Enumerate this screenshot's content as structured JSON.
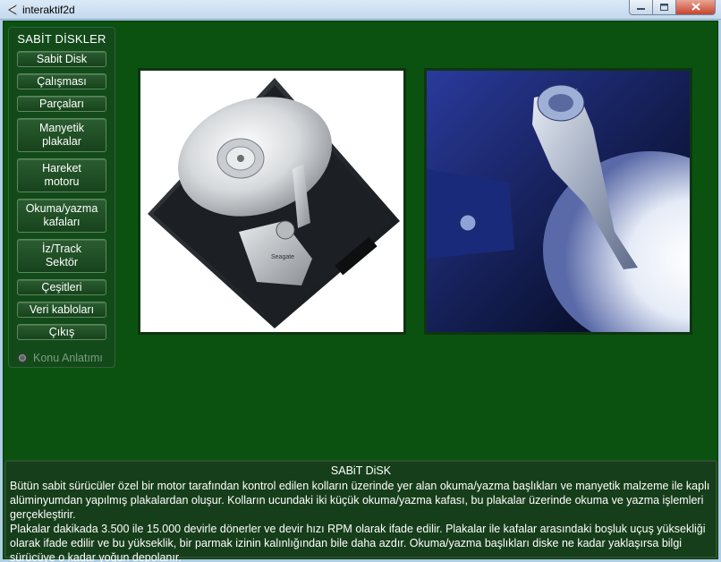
{
  "window": {
    "title": "interaktif2d",
    "minimize_icon": "minimize-icon",
    "maximize_icon": "maximize-icon",
    "close_icon": "close-icon"
  },
  "sidebar": {
    "title": "SABİT DİSKLER",
    "items": [
      {
        "label": "Sabit Disk"
      },
      {
        "label": "Çalışması"
      },
      {
        "label": "Parçaları"
      },
      {
        "label": "Manyetik\nplakalar"
      },
      {
        "label": "Hareket\nmotoru"
      },
      {
        "label": "Okuma/yazma\nkafaları"
      },
      {
        "label": "İz/Track\nSektör"
      },
      {
        "label": "Çeşitleri"
      },
      {
        "label": "Veri kabloları"
      },
      {
        "label": "Çıkış"
      }
    ],
    "radio_label": "Konu Anlatımı"
  },
  "images": {
    "left": {
      "name": "hard-disk-photo",
      "brand": "Seagate"
    },
    "right": {
      "name": "read-write-head-photo"
    }
  },
  "info": {
    "title": "SABiT DiSK",
    "paragraph1": "Bütün sabit sürücüler özel bir motor tarafından kontrol edilen kolların üzerinde yer alan okuma/yazma başlıkları ve manyetik malzeme ile kaplı alüminyumdan yapılmış plakalardan oluşur. Kolların ucundaki iki küçük okuma/yazma kafası, bu plakalar üzerinde okuma ve yazma işlemleri gerçekleştirir.",
    "paragraph2": "Plakalar dakikada 3.500 ile 15.000 devirle dönerler ve devir hızı RPM olarak ifade edilir. Plakalar ile kafalar arasındaki boşluk uçuş yüksekliği olarak ifade edilir ve bu yükseklik, bir parmak izinin kalınlığından bile daha azdır. Okuma/yazma başlıkları diske ne kadar yaklaşırsa bilgi sürücüye o kadar yoğun depolanır."
  },
  "colors": {
    "background": "#0b5210",
    "panel": "#134a1a",
    "info_panel": "#163e1a",
    "button": "#1f4f24",
    "text": "#ffffff",
    "disabled_text": "#7d9b80"
  }
}
